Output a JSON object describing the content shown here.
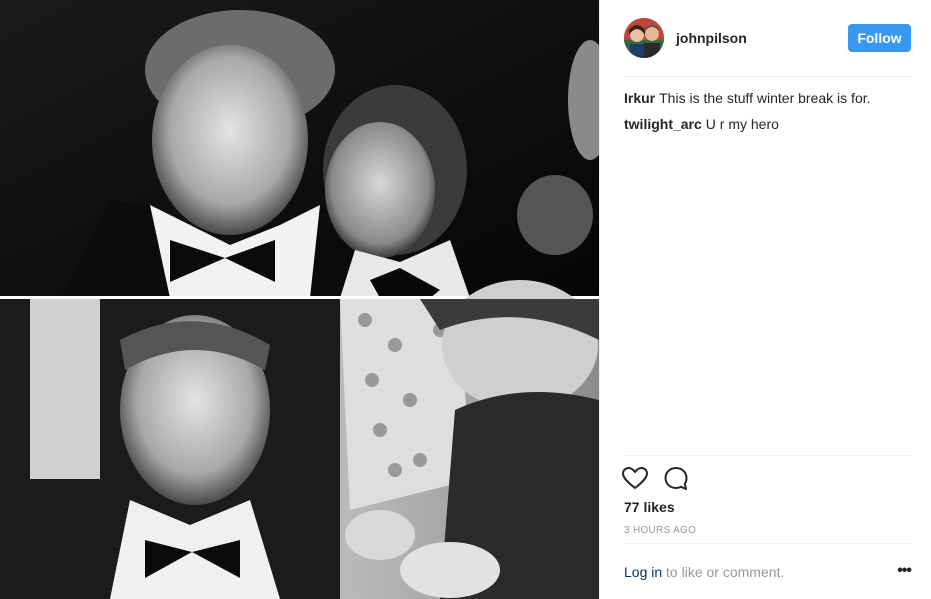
{
  "post": {
    "username": "johnpilson",
    "follow_label": "Follow",
    "comments": [
      {
        "user": "Irkur",
        "text": "This is the stuff winter break is for."
      },
      {
        "user": "twilight_arc",
        "text": "U r my hero"
      }
    ],
    "likes_text": "77 likes",
    "time_text": "3 HOURS AGO",
    "login_link": "Log in",
    "login_rest": " to like or comment.",
    "more_label": "•••"
  },
  "icons": {
    "like": "heart-icon",
    "comment": "comment-bubble-icon",
    "more": "more-options-icon"
  },
  "colors": {
    "follow_button": "#3897f0",
    "link": "#003569",
    "muted": "#999999"
  }
}
